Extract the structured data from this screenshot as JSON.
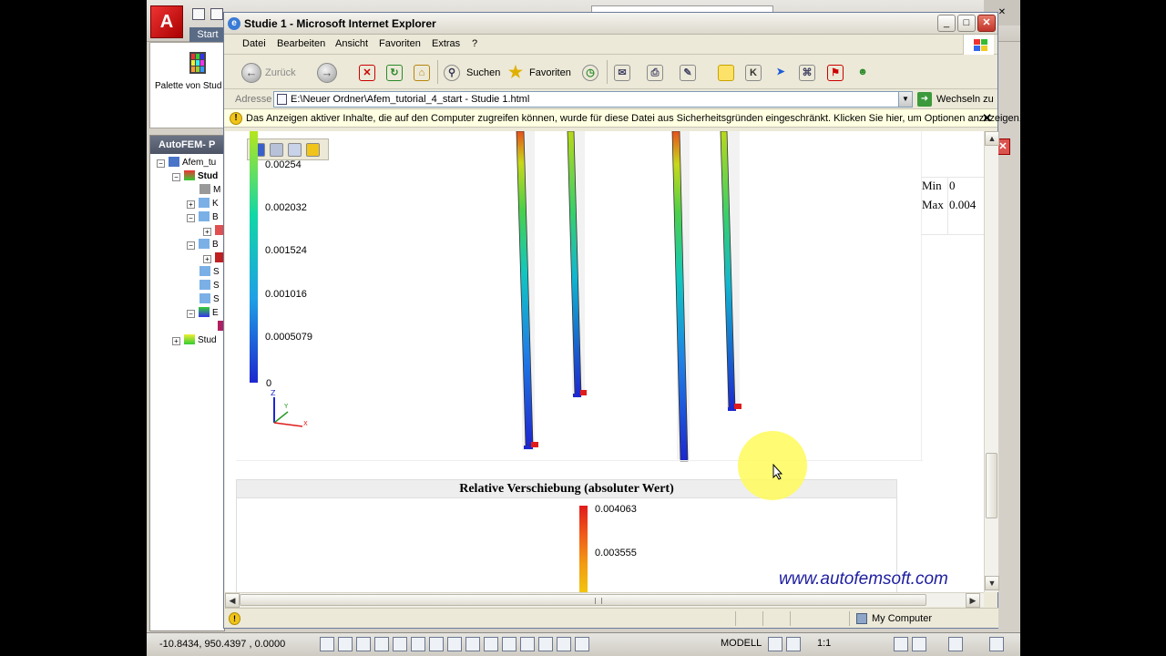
{
  "autocad": {
    "start_label": "Start",
    "palette_label": "Palette von Stud",
    "panel_title": "AutoFEM- P",
    "tree": {
      "root_label": "Afem_tu",
      "study_label": "Stud",
      "study2_label": "Stud",
      "item_m": "M",
      "item_k": "K",
      "item_b1": "B",
      "item_b2": "B",
      "item_s1": "S",
      "item_s2": "S",
      "item_s3": "S",
      "item_e": "E"
    },
    "coordinates": "-10.8434, 950.4397 , 0.0000",
    "model_label": "MODELL",
    "scale_label": "1:1"
  },
  "ie": {
    "title": "Studie 1 - Microsoft Internet Explorer",
    "menu": [
      "Datei",
      "Bearbeiten",
      "Ansicht",
      "Favoriten",
      "Extras",
      "?"
    ],
    "toolbar": {
      "back_label": "Zurück",
      "search_label": "Suchen",
      "favorites_label": "Favoriten"
    },
    "address_label": "Adresse",
    "address_value": "E:\\Neuer Ordner\\Afem_tutorial_4_start - Studie 1.html",
    "go_label": "Wechseln zu",
    "infobar_text": "Das Anzeigen aktiver Inhalte, die auf den Computer zugreifen können, wurde für diese Datei aus Sicherheitsgründen eingeschränkt. Klicken Sie hier, um Optionen anzuzeigen...",
    "status_zone": "My Computer"
  },
  "page": {
    "legend1": {
      "values": [
        "0.00254",
        "0.002032",
        "0.001524",
        "0.001016",
        "0.0005079",
        "0"
      ]
    },
    "axis_labels": {
      "z": "Z",
      "y": "Y",
      "x": "X"
    },
    "minmax": {
      "min_label": "Min",
      "min_value": "0",
      "max_label": "Max",
      "max_value": "0.004"
    },
    "section_title": "Relative Verschiebung (absoluter Wert)",
    "legend2": {
      "values": [
        "0.004063",
        "0.003555"
      ]
    },
    "watermark": "www.autofemsoft.com"
  },
  "colors": {
    "accent_blue": "#1d28ce",
    "accent_red": "#e01b1b",
    "highlight": "#fff85a",
    "infobar": "#ffffe1"
  }
}
